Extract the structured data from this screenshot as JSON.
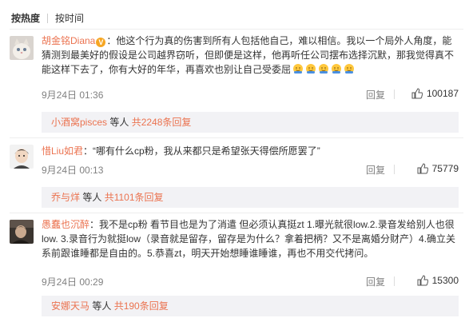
{
  "sort": {
    "hot": "按热度",
    "time": "按时间"
  },
  "comments": [
    {
      "name": "胡金铭Diana",
      "badge": "V",
      "text": "：他这个行为真的伤害到所有人包括他自己，难以相信。我以一个局外人角度，能猜测到最美好的假设是公司越界窃听，但即便是这样，他再听任公司摆布选择沉默，那我觉得真不能这样下去了，你有大好的年华，再喜欢也别让自己受委屈",
      "emoji_count": 5,
      "time": "9月24日 01:36",
      "reply": "回复",
      "likes": "100187",
      "sub": {
        "who": "小酒窝pisces",
        "mid": " 等人 ",
        "count": "共2248条回复"
      }
    },
    {
      "name": "惜Liu如君",
      "text": "：“哪有什么cp粉，我从来都只是希望张天得偿所愿罢了”",
      "time": "9月24日 00:13",
      "reply": "回复",
      "likes": "75779",
      "sub": {
        "who": "乔与烊",
        "mid": " 等人 ",
        "count": "共1101条回复"
      }
    },
    {
      "name": "愚蠢也沉醉",
      "text": "：我不是cp粉 看节目也是为了消遣 但必须认真挺zt 1.曝光就很low.2.录音发给别人也很low. 3.录音行为就挺low（录音就是留存，留存是为什么？拿着把柄？又不是离婚分财产）4.确立关系前跟谁睡都是自由的。5.恭喜zt，明天开始想睡谁睡谁，再也不用交代拷问。",
      "time": "9月24日 00:29",
      "reply": "回复",
      "likes": "15300",
      "sub": {
        "who": "安娜天马",
        "mid": " 等人 ",
        "count": "共190条回复"
      }
    }
  ],
  "colors": {
    "name": "#eb7350",
    "meta": "#808080",
    "replybox": "#f2f2f5"
  }
}
